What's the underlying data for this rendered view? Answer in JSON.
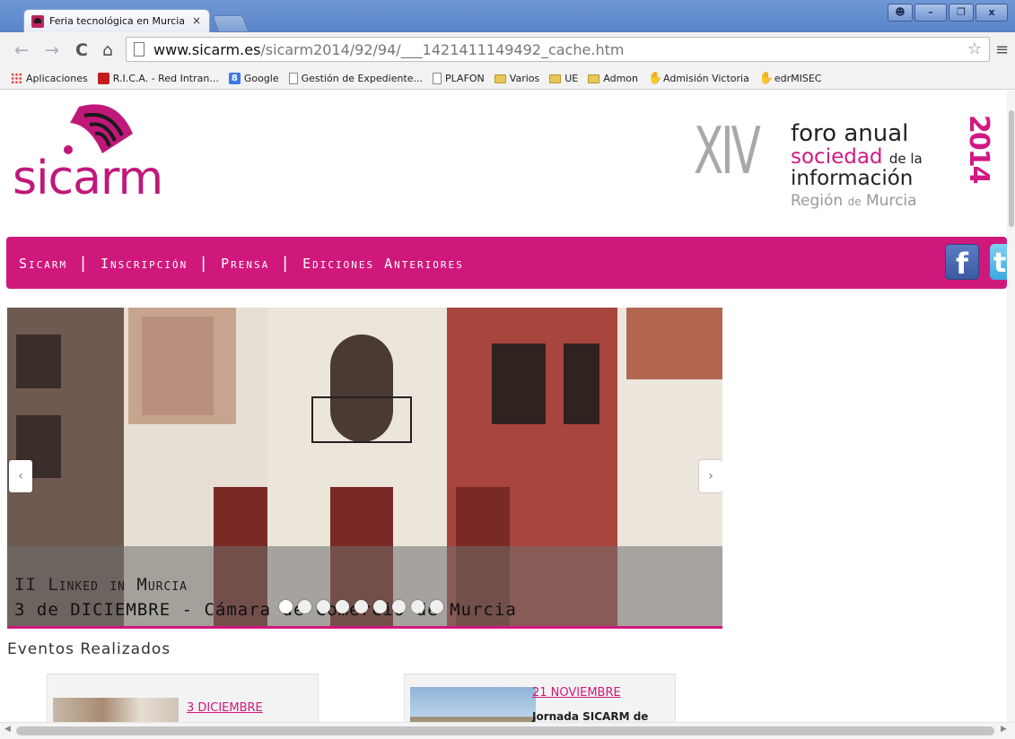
{
  "browser": {
    "tab_title": "Feria tecnológica en Murcia, S",
    "tab_close": "×",
    "url_host": "www.sicarm.es",
    "url_path": "/sicarm2014/92/94/___1421411149492_cache.htm",
    "icons": [
      "back-icon",
      "forward-icon",
      "reload-icon",
      "home-icon",
      "page-icon",
      "star-icon",
      "menu-icon"
    ],
    "bookmarks": [
      {
        "label": "Aplicaciones",
        "icon": "apps-icon"
      },
      {
        "label": "R.I.C.A. - Red Intran...",
        "icon": "rica-icon"
      },
      {
        "label": "Google",
        "icon": "google-icon"
      },
      {
        "label": "Gestión de Expediente...",
        "icon": "page-icon"
      },
      {
        "label": "PLAFON",
        "icon": "page-icon"
      },
      {
        "label": "Varios",
        "icon": "folder-icon"
      },
      {
        "label": "UE",
        "icon": "folder-icon"
      },
      {
        "label": "Admon",
        "icon": "folder-icon"
      },
      {
        "label": "Admisión Victoria",
        "icon": "hand-icon"
      },
      {
        "label": "edrMISEC",
        "icon": "hand-icon"
      }
    ]
  },
  "site": {
    "logo_text": "sicarm",
    "foro": {
      "roman": "XIV",
      "line1": "foro anual",
      "line2_main": "sociedad",
      "line2_small": "de la",
      "line3": "información",
      "line4_main": "Región",
      "line4_small": "de",
      "line4_end": "Murcia",
      "year": "2014"
    },
    "brand_color": "#d0187c",
    "nav": [
      "Sicarm",
      "Inscripción",
      "Prensa",
      "Ediciones Anteriores"
    ],
    "nav_separator": "|",
    "social": {
      "facebook": "f",
      "twitter": "t"
    },
    "slider": {
      "caption_title": "II Linked in Murcia",
      "caption_subtitle": "3 de DICIEMBRE - Cámara de Comercio de Murcia",
      "prev": "‹",
      "next": "›",
      "dot_count": 9
    },
    "events_title": "Eventos Realizados",
    "events": [
      {
        "date": "3 DICIEMBRE",
        "text": ""
      },
      {
        "date": "21 NOVIEMBRE",
        "text": "Jornada SICARM de"
      }
    ]
  }
}
